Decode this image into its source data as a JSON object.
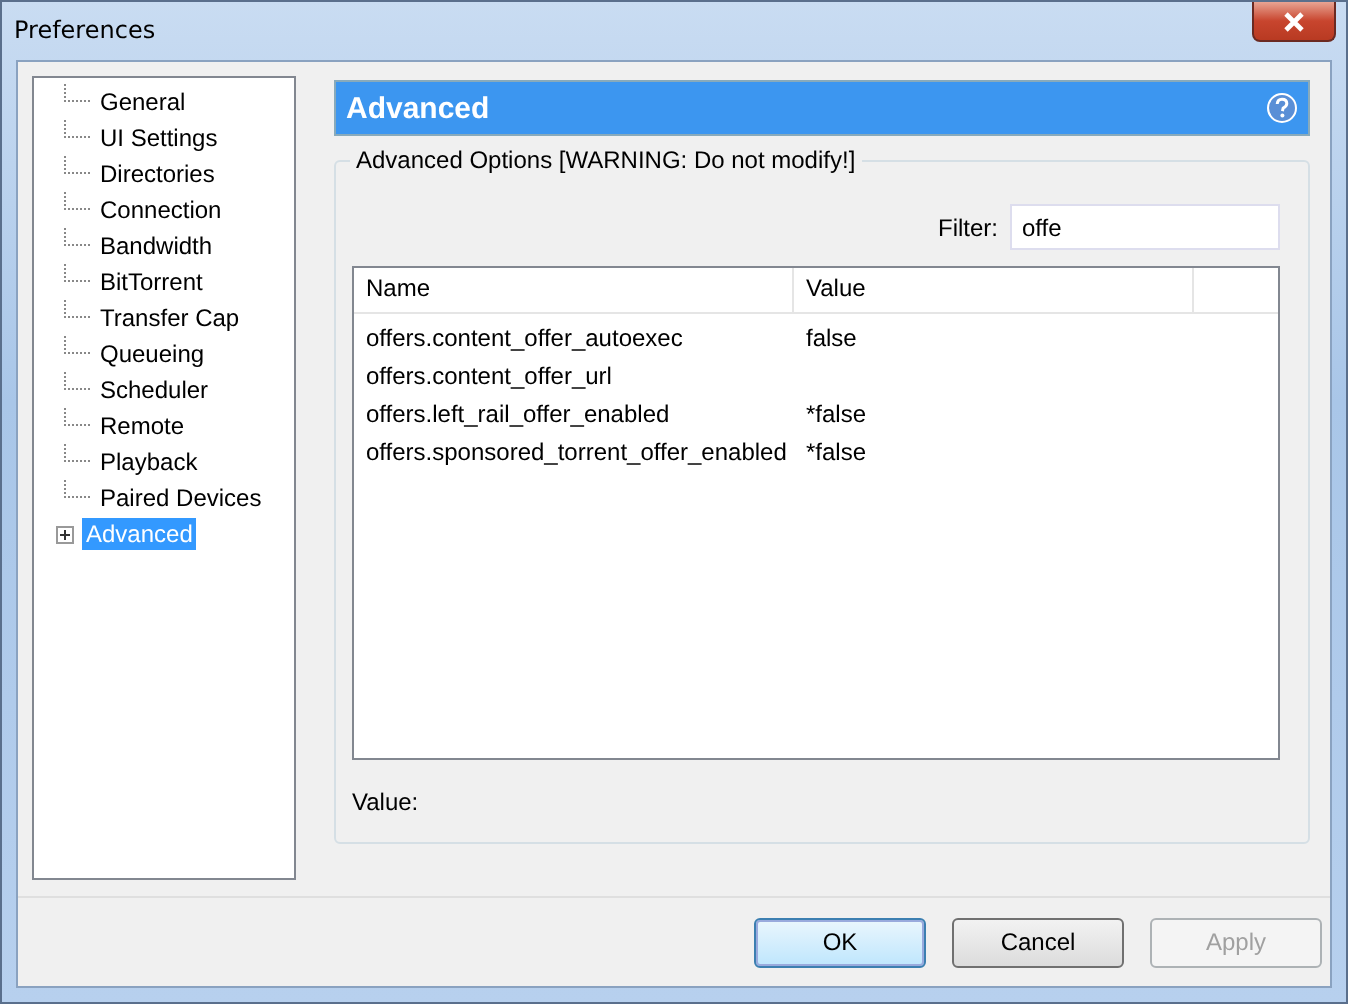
{
  "window": {
    "title": "Preferences"
  },
  "sidebar": {
    "items": [
      {
        "label": "General",
        "selected": false,
        "expandable": false
      },
      {
        "label": "UI Settings",
        "selected": false,
        "expandable": false
      },
      {
        "label": "Directories",
        "selected": false,
        "expandable": false
      },
      {
        "label": "Connection",
        "selected": false,
        "expandable": false
      },
      {
        "label": "Bandwidth",
        "selected": false,
        "expandable": false
      },
      {
        "label": "BitTorrent",
        "selected": false,
        "expandable": false
      },
      {
        "label": "Transfer Cap",
        "selected": false,
        "expandable": false
      },
      {
        "label": "Queueing",
        "selected": false,
        "expandable": false
      },
      {
        "label": "Scheduler",
        "selected": false,
        "expandable": false
      },
      {
        "label": "Remote",
        "selected": false,
        "expandable": false
      },
      {
        "label": "Playback",
        "selected": false,
        "expandable": false
      },
      {
        "label": "Paired Devices",
        "selected": false,
        "expandable": false
      },
      {
        "label": "Advanced",
        "selected": true,
        "expandable": true
      }
    ]
  },
  "panel": {
    "title": "Advanced",
    "group_title": "Advanced Options [WARNING: Do not modify!]",
    "filter": {
      "label": "Filter:",
      "value": "offe"
    },
    "table": {
      "columns": [
        "Name",
        "Value"
      ],
      "rows": [
        {
          "name": "offers.content_offer_autoexec",
          "value": "false"
        },
        {
          "name": "offers.content_offer_url",
          "value": ""
        },
        {
          "name": "offers.left_rail_offer_enabled",
          "value": "*false"
        },
        {
          "name": "offers.sponsored_torrent_offer_enabled",
          "value": "*false"
        }
      ]
    },
    "value_label": "Value:"
  },
  "buttons": [
    {
      "label": "OK",
      "default": true,
      "disabled": false
    },
    {
      "label": "Cancel",
      "default": false,
      "disabled": false
    },
    {
      "label": "Apply",
      "default": false,
      "disabled": true
    }
  ]
}
